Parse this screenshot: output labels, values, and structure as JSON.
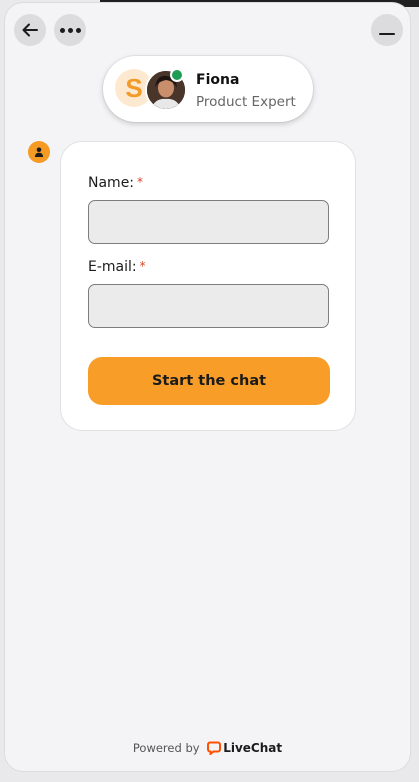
{
  "agent": {
    "name": "Fiona",
    "role": "Product Expert",
    "status": "online",
    "logo_letter": "S"
  },
  "form": {
    "name_label": "Name:",
    "email_label": "E-mail:",
    "required_mark": "*",
    "name_value": "",
    "email_value": "",
    "submit_label": "Start the chat"
  },
  "footer": {
    "powered_by": "Powered by",
    "brand": "LiveChat"
  },
  "colors": {
    "accent": "#f89d28",
    "online": "#1e9e55",
    "required": "#d9432b"
  }
}
